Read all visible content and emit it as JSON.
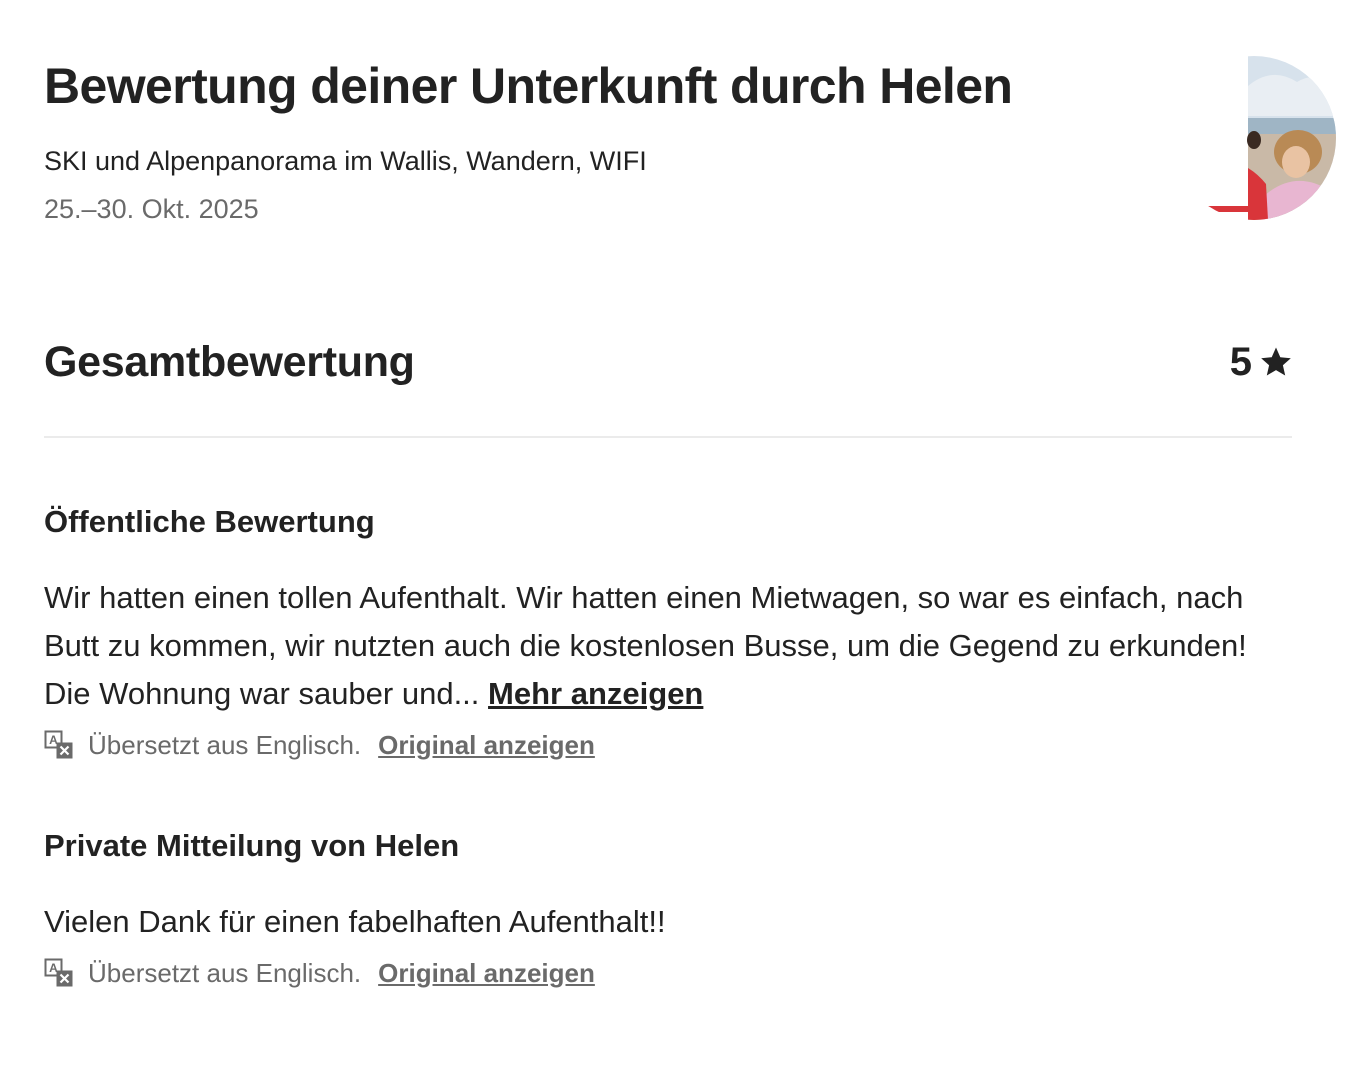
{
  "header": {
    "title": "Bewertung deiner Unterkunft durch Helen",
    "listing_name": "SKI und Alpenpanorama im Wallis, Wandern, WIFI",
    "dates": "25.–30. Okt. 2025",
    "avatar_alt": "Helen"
  },
  "overall": {
    "label": "Gesamtbewertung",
    "rating": "5",
    "icon": "star-icon"
  },
  "public_review": {
    "heading": "Öffentliche Bewertung",
    "text": "Wir hatten einen tollen Aufenthalt. Wir hatten einen Mietwagen, so war es einfach, nach Butt zu kommen, wir nutzten auch die kostenlosen Busse, um die Gegend zu erkunden! Die Wohnung war sauber und...",
    "more_label": "Mehr anzeigen",
    "translation_note": "Übersetzt aus Englisch.",
    "original_label": "Original anzeigen"
  },
  "private_message": {
    "heading": "Private Mitteilung von Helen",
    "text": "Vielen Dank für einen fabelhaften Aufenthalt!!",
    "translation_note": "Übersetzt aus Englisch.",
    "original_label": "Original anzeigen"
  },
  "colors": {
    "text_primary": "#222222",
    "text_secondary": "#6a6a6a",
    "divider": "#ebebeb"
  }
}
